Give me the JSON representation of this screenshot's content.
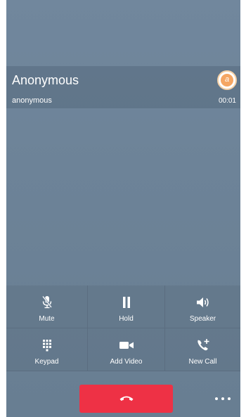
{
  "call": {
    "caller_name": "Anonymous",
    "caller_id": "anonymous",
    "duration": "00:01",
    "avatar_letter": "a"
  },
  "controls": [
    {
      "label": "Mute",
      "icon": "microphone-muted-icon"
    },
    {
      "label": "Hold",
      "icon": "pause-icon"
    },
    {
      "label": "Speaker",
      "icon": "speaker-icon"
    },
    {
      "label": "Keypad",
      "icon": "keypad-icon"
    },
    {
      "label": "Add Video",
      "icon": "video-camera-icon"
    },
    {
      "label": "New Call",
      "icon": "phone-add-icon"
    }
  ],
  "end_call": {
    "icon": "hang-up-icon"
  },
  "more": {
    "icon": "more-options-icon"
  },
  "colors": {
    "background": "#6d8398",
    "end_call": "#ee3145",
    "avatar": "#f5a663"
  }
}
